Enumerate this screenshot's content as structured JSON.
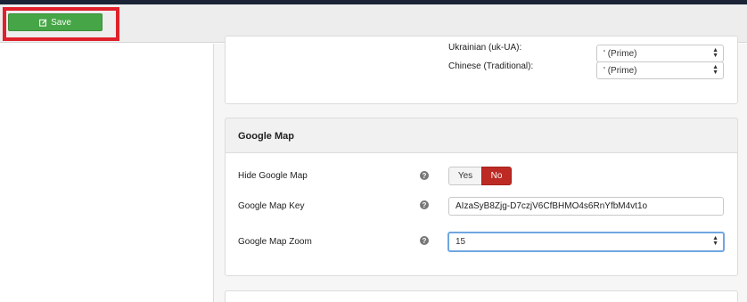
{
  "toolbar": {
    "save_label": "Save",
    "save_icon": "edit-icon"
  },
  "languages": [
    {
      "label": "Ukrainian (uk-UA):",
      "value": "' (Prime)"
    },
    {
      "label": "Chinese (Traditional):",
      "value": "' (Prime)"
    }
  ],
  "google_map": {
    "title": "Google Map",
    "hide_label": "Hide Google Map",
    "hide_options": {
      "yes": "Yes",
      "no": "No",
      "selected": "No"
    },
    "key_label": "Google Map Key",
    "key_value": "AIzaSyB8Zjg-D7czjV6CfBHMO4s6RnYfbM4vt1o",
    "zoom_label": "Google Map Zoom",
    "zoom_value": "15",
    "help_icon": "question-circle-icon"
  },
  "colors": {
    "save_green": "#46a546",
    "highlight_red": "#e0202a",
    "no_active_red": "#bd2a24",
    "focus_blue": "#6fa6e0"
  }
}
